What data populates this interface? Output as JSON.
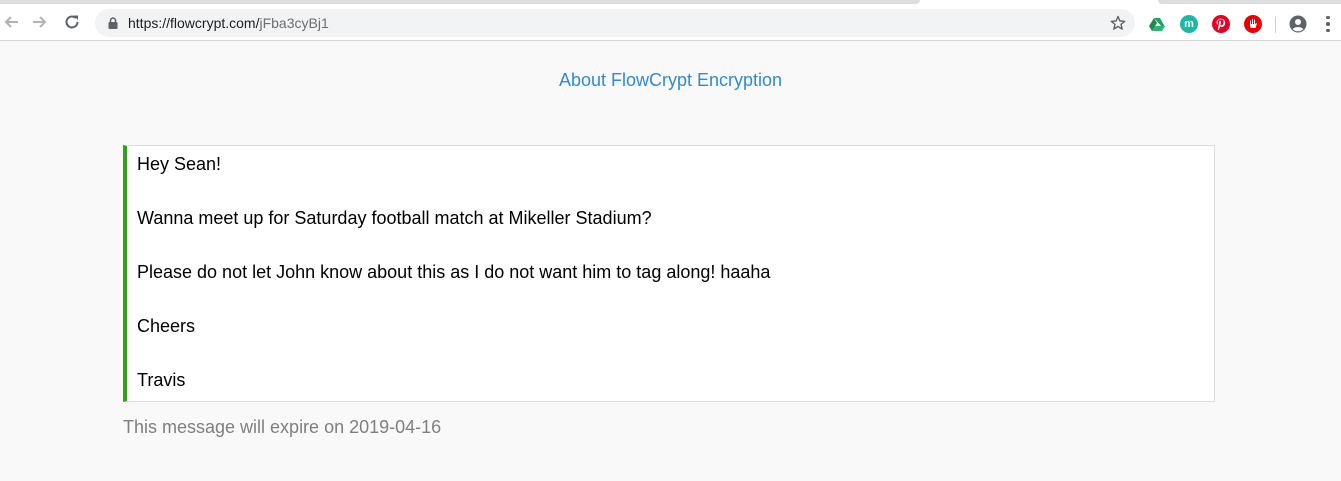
{
  "browser": {
    "url_host": "https://flowcrypt.com/",
    "url_path": "jFba3cyBj1",
    "extensions": {
      "mercury_glyph": "m"
    },
    "icons": [
      "back-arrow-icon",
      "forward-arrow-icon",
      "reload-icon",
      "lock-icon",
      "bookmark-star-icon",
      "google-drive-icon",
      "mercury-icon",
      "pinterest-icon",
      "adblock-icon",
      "profile-icon",
      "menu-dots-icon"
    ]
  },
  "page": {
    "about_link": "About FlowCrypt Encryption",
    "message_lines": [
      "Hey Sean!",
      "Wanna meet up for Saturday football match at Mikeller Stadium?",
      "Please do not let John know about this as I do not want him to tag along! haaha",
      "Cheers",
      "Travis"
    ],
    "expire_prefix": "This message will expire on ",
    "expire_date": "2019-04-16"
  },
  "colors": {
    "link": "#2d8bd6",
    "message_accent": "#31a217",
    "expire_text": "#7f7f7f",
    "page_background": "#f9f9f9"
  }
}
